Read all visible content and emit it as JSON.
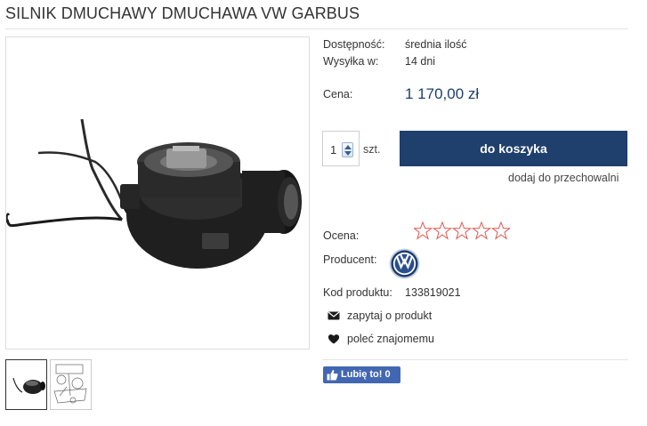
{
  "product": {
    "title": "SILNIK DMUCHAWY DMUCHAWA VW GARBUS",
    "availability_label": "Dostępność:",
    "availability_value": "średnia ilość",
    "shipping_label": "Wysyłka w:",
    "shipping_value": "14 dni",
    "price_label": "Cena:",
    "price_value": "1 170,00 zł",
    "quantity_value": "1",
    "quantity_unit": "szt.",
    "add_to_cart_label": "do koszyka",
    "store_label": "dodaj do przechowalni",
    "rating_label": "Ocena:",
    "rating_value": 0,
    "rating_max": 5,
    "producer_label": "Producent:",
    "producer_logo": "vw-logo",
    "code_label": "Kod produktu:",
    "code_value": "133819021",
    "ask_label": "zapytaj o produkt",
    "recommend_label": "poleć znajomemu",
    "like_label": "Lubię to! 0"
  },
  "colors": {
    "accent": "#1f3f6d",
    "price": "#1d3f70",
    "star_outline": "#e0574f",
    "facebook": "#4267b2"
  },
  "icons": {
    "ask": "envelope-icon",
    "recommend": "heart-icon",
    "like": "thumbs-up-icon"
  }
}
